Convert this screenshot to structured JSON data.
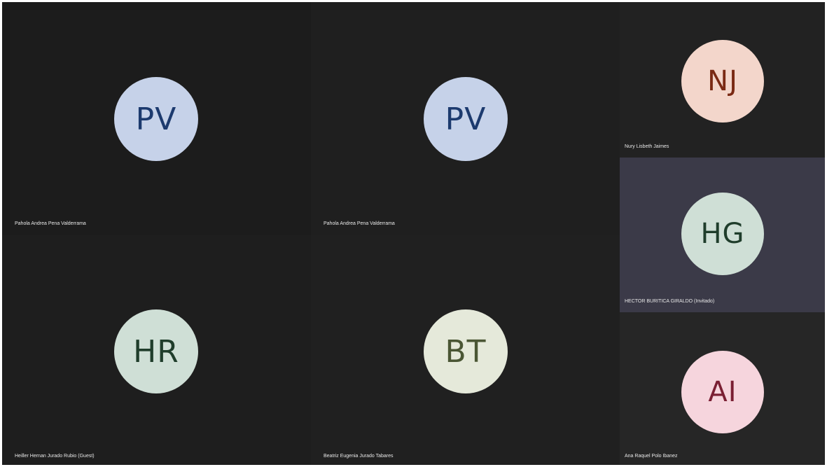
{
  "participants": [
    {
      "initials": "PV",
      "name": "Pahola Andrea Pena Valderrama",
      "tile_bg": "#1c1c1c",
      "avatar_bg": "#c6d2e9",
      "avatar_fg": "#1c3a6e"
    },
    {
      "initials": "PV",
      "name": "Pahola Andrea Pena Valderrama",
      "tile_bg": "#1f1f1f",
      "avatar_bg": "#c6d2e9",
      "avatar_fg": "#1c3a6e"
    },
    {
      "initials": "NJ",
      "name": "Nury Lisbeth Jaimes",
      "tile_bg": "#222222",
      "avatar_bg": "#f3d6cb",
      "avatar_fg": "#7a2a14"
    },
    {
      "initials": "HG",
      "name": "HECTOR BURITICA GIRALDO (Invitado)",
      "tile_bg": "#3b3a48",
      "avatar_bg": "#cfdfd6",
      "avatar_fg": "#1f3d2b"
    },
    {
      "initials": "HR",
      "name": "Heiller Hernan Jurado Rubio (Guest)",
      "tile_bg": "#1e1e1e",
      "avatar_bg": "#cfdfd6",
      "avatar_fg": "#1f3d2b"
    },
    {
      "initials": "BT",
      "name": "Beatriz Eugenia Jurado Tabares",
      "tile_bg": "#202020",
      "avatar_bg": "#e5e9da",
      "avatar_fg": "#4a5634"
    },
    {
      "initials": "AI",
      "name": "Ana Raquel Polo Ibanez",
      "tile_bg": "#262626",
      "avatar_bg": "#f6d5dd",
      "avatar_fg": "#7a1f33"
    }
  ]
}
